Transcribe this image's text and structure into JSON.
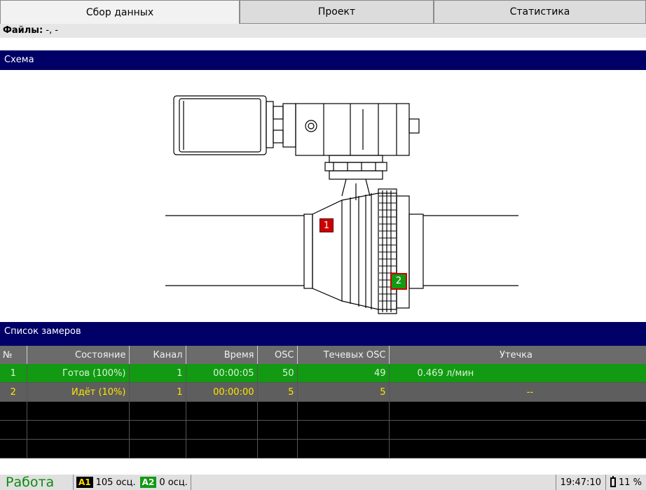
{
  "tabs": [
    {
      "label": "Сбор данных",
      "active": true
    },
    {
      "label": "Проект",
      "active": false
    },
    {
      "label": "Статистика",
      "active": false
    }
  ],
  "files": {
    "label": "Файлы:",
    "value": " -, -"
  },
  "scheme": {
    "header": "Схема",
    "marker1": "1",
    "marker2": "2",
    "marker1_color": "#cc0000",
    "marker2_color": "#129a12"
  },
  "list": {
    "header": "Список замеров",
    "columns": [
      "№",
      "Состояние",
      "Канал",
      "Время",
      "OSC",
      "Течевых OSC",
      "Утечка"
    ],
    "rows": [
      {
        "num": "1",
        "state": "Готов (100%)",
        "channel": "1",
        "time": "00:00:05",
        "osc": "50",
        "leak_osc": "49",
        "leak": "0.469 л/мин"
      },
      {
        "num": "2",
        "state": "Идёт (10%)",
        "channel": "1",
        "time": "00:00:00",
        "osc": "5",
        "leak_osc": "5",
        "leak": "--"
      }
    ]
  },
  "status": {
    "mode": "Работа",
    "a1_label": "A1",
    "a1_value": "105 осц.",
    "a2_label": "A2",
    "a2_value": "0 осц.",
    "time": "19:47:10",
    "battery": "11 %"
  },
  "colors": {
    "header_bg": "#000066",
    "ok_row": "#129a12",
    "running_text": "#ffe600"
  }
}
